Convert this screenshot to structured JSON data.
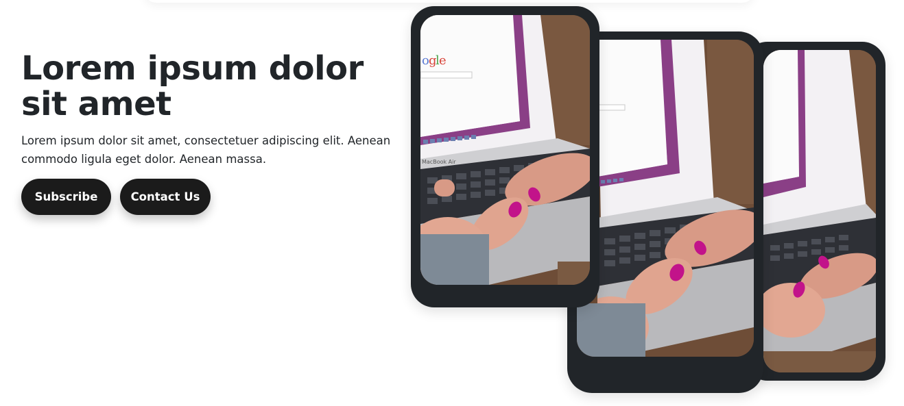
{
  "hero": {
    "title": "Lorem ipsum dolor sit amet",
    "subtitle": "Lorem ipsum dolor sit amet, consectetuer adipiscing elit. Aenean commodo ligula eget dolor. Aenean massa.",
    "buttons": {
      "subscribe": "Subscribe",
      "contact": "Contact Us"
    }
  },
  "phones": [
    {
      "image": "woman typing on laptop photo",
      "laptop_label": "MacBook Air"
    },
    {
      "image": "woman typing on laptop photo"
    },
    {
      "image": "woman typing on laptop photo"
    }
  ],
  "colors": {
    "text": "#212529",
    "button_bg": "#1b1b1b",
    "button_text": "#ffffff",
    "phone_frame": "#212529",
    "background": "#ffffff"
  }
}
